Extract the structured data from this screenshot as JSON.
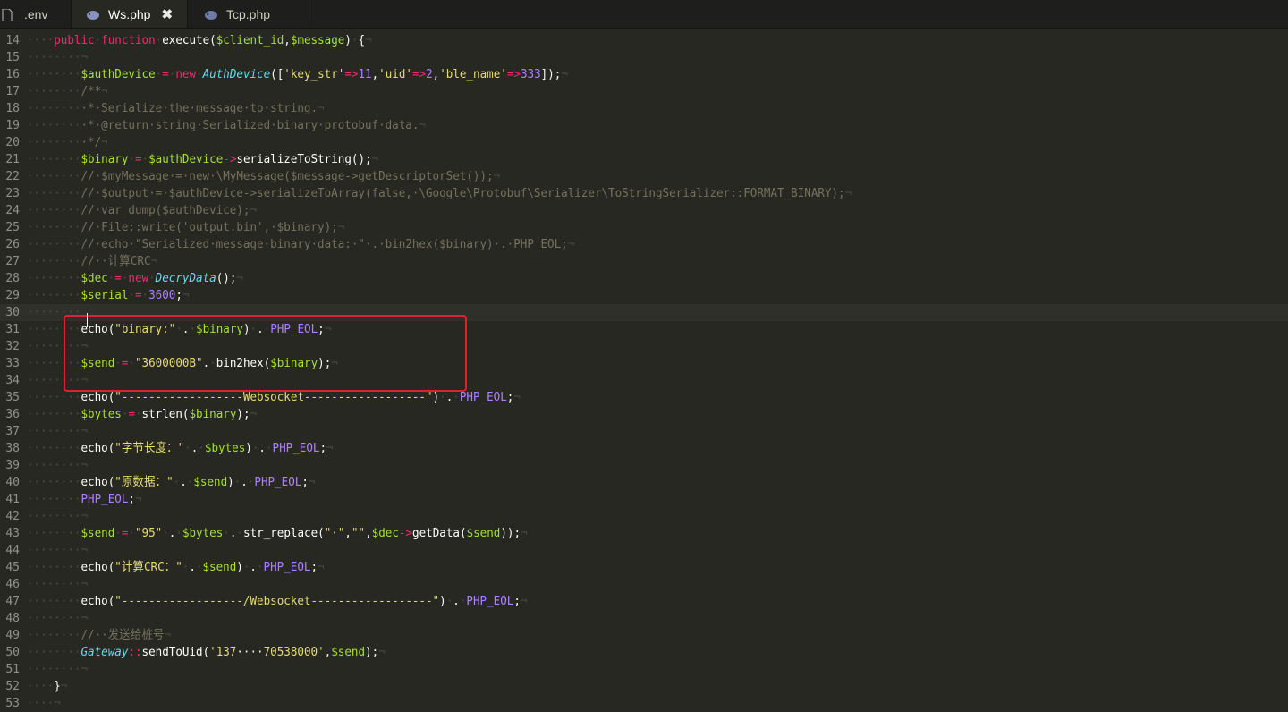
{
  "tabs": [
    {
      "label": ".env",
      "active": false,
      "closable": false
    },
    {
      "label": "Ws.php",
      "active": true,
      "closable": true
    },
    {
      "label": "Tcp.php",
      "active": false,
      "closable": false
    }
  ],
  "close_glyph": "✖",
  "current_line": 30,
  "highlight_box": {
    "color": "#e0202f",
    "from_line": 30,
    "to_line": 33
  },
  "colors": {
    "background": "#272822",
    "keyword": "#f92672",
    "variable": "#a6e22e",
    "string": "#e6db74",
    "number": "#ae81ff",
    "class": "#66d9ef",
    "comment": "#75715e",
    "whitespace": "#4a4b42"
  },
  "code_lines": [
    {
      "n": "13",
      "segs": [
        [
          "ws",
          "····¬"
        ]
      ]
    },
    {
      "n": "14",
      "segs": [
        [
          "ws",
          "····"
        ],
        [
          "kw",
          "public"
        ],
        [
          "ws",
          "·"
        ],
        [
          "kw",
          "function"
        ],
        [
          "ws",
          "·"
        ],
        [
          "fn",
          "execute"
        ],
        [
          "pun",
          "("
        ],
        [
          "var",
          "$client_id"
        ],
        [
          "pun",
          ","
        ],
        [
          "var",
          "$message"
        ],
        [
          "pun",
          ")"
        ],
        [
          "ws",
          "·"
        ],
        [
          "pun",
          "{"
        ],
        [
          "eol",
          "¬"
        ]
      ]
    },
    {
      "n": "15",
      "segs": [
        [
          "ws",
          "········¬"
        ]
      ]
    },
    {
      "n": "16",
      "segs": [
        [
          "ws",
          "········"
        ],
        [
          "var",
          "$authDevice"
        ],
        [
          "ws",
          "·"
        ],
        [
          "op",
          "="
        ],
        [
          "ws",
          "·"
        ],
        [
          "kw",
          "new"
        ],
        [
          "ws",
          "·"
        ],
        [
          "cls",
          "AuthDevice"
        ],
        [
          "pun",
          "(["
        ],
        [
          "str",
          "'key_str'"
        ],
        [
          "op",
          "=>"
        ],
        [
          "num",
          "11"
        ],
        [
          "pun",
          ","
        ],
        [
          "str",
          "'uid'"
        ],
        [
          "op",
          "=>"
        ],
        [
          "num",
          "2"
        ],
        [
          "pun",
          ","
        ],
        [
          "str",
          "'ble_name'"
        ],
        [
          "op",
          "=>"
        ],
        [
          "num",
          "333"
        ],
        [
          "pun",
          "]);"
        ],
        [
          "eol",
          "¬"
        ]
      ]
    },
    {
      "n": "17",
      "segs": [
        [
          "ws",
          "········"
        ],
        [
          "cmt",
          "/**"
        ],
        [
          "eol",
          "¬"
        ]
      ]
    },
    {
      "n": "18",
      "segs": [
        [
          "ws",
          "········"
        ],
        [
          "cmt",
          "·*·Serialize·the·message·to·string."
        ],
        [
          "eol",
          "¬"
        ]
      ]
    },
    {
      "n": "19",
      "segs": [
        [
          "ws",
          "········"
        ],
        [
          "cmt",
          "·*·@return·string·Serialized·binary·protobuf·data."
        ],
        [
          "eol",
          "¬"
        ]
      ]
    },
    {
      "n": "20",
      "segs": [
        [
          "ws",
          "········"
        ],
        [
          "cmt",
          "·*/"
        ],
        [
          "eol",
          "¬"
        ]
      ]
    },
    {
      "n": "21",
      "segs": [
        [
          "ws",
          "········"
        ],
        [
          "var",
          "$binary"
        ],
        [
          "ws",
          "·"
        ],
        [
          "op",
          "="
        ],
        [
          "ws",
          "·"
        ],
        [
          "var",
          "$authDevice"
        ],
        [
          "op",
          "->"
        ],
        [
          "fn",
          "serializeToString"
        ],
        [
          "pun",
          "();"
        ],
        [
          "eol",
          "¬"
        ]
      ]
    },
    {
      "n": "22",
      "segs": [
        [
          "ws",
          "········"
        ],
        [
          "cmt",
          "//·$myMessage·=·new·\\MyMessage($message->getDescriptorSet());"
        ],
        [
          "eol",
          "¬"
        ]
      ]
    },
    {
      "n": "23",
      "segs": [
        [
          "ws",
          "········"
        ],
        [
          "cmt",
          "//·$output·=·$authDevice->serializeToArray(false,·\\Google\\Protobuf\\Serializer\\ToStringSerializer::FORMAT_BINARY);"
        ],
        [
          "eol",
          "¬"
        ]
      ]
    },
    {
      "n": "24",
      "segs": [
        [
          "ws",
          "········"
        ],
        [
          "cmt",
          "//·var_dump($authDevice);"
        ],
        [
          "eol",
          "¬"
        ]
      ]
    },
    {
      "n": "25",
      "segs": [
        [
          "ws",
          "········"
        ],
        [
          "cmt",
          "//·File::write('output.bin',·$binary);"
        ],
        [
          "eol",
          "¬"
        ]
      ]
    },
    {
      "n": "26",
      "segs": [
        [
          "ws",
          "········"
        ],
        [
          "cmt",
          "//·echo·\"Serialized·message·binary·data:·\"·.·bin2hex($binary)·.·PHP_EOL;"
        ],
        [
          "eol",
          "¬"
        ]
      ]
    },
    {
      "n": "27",
      "segs": [
        [
          "ws",
          "········"
        ],
        [
          "cmt",
          "//··计算CRC"
        ],
        [
          "eol",
          "¬"
        ]
      ]
    },
    {
      "n": "28",
      "segs": [
        [
          "ws",
          "········"
        ],
        [
          "var",
          "$dec"
        ],
        [
          "ws",
          "·"
        ],
        [
          "op",
          "="
        ],
        [
          "ws",
          "·"
        ],
        [
          "kw",
          "new"
        ],
        [
          "ws",
          "·"
        ],
        [
          "cls",
          "DecryData"
        ],
        [
          "pun",
          "();"
        ],
        [
          "eol",
          "¬"
        ]
      ]
    },
    {
      "n": "29",
      "segs": [
        [
          "ws",
          "········"
        ],
        [
          "var",
          "$serial"
        ],
        [
          "ws",
          "·"
        ],
        [
          "op",
          "="
        ],
        [
          "ws",
          "·"
        ],
        [
          "num",
          "3600"
        ],
        [
          "pun",
          ";"
        ],
        [
          "eol",
          "¬"
        ]
      ]
    },
    {
      "n": "30",
      "segs": [
        [
          "ws",
          "········"
        ]
      ]
    },
    {
      "n": "31",
      "segs": [
        [
          "ws",
          "········"
        ],
        [
          "fn",
          "echo"
        ],
        [
          "pun",
          "("
        ],
        [
          "str",
          "\"binary:\""
        ],
        [
          "ws",
          "·"
        ],
        [
          "pun",
          "."
        ],
        [
          "ws",
          "·"
        ],
        [
          "var",
          "$binary"
        ],
        [
          "pun",
          ")"
        ],
        [
          "ws",
          "·"
        ],
        [
          "pun",
          "."
        ],
        [
          "ws",
          "·"
        ],
        [
          "const",
          "PHP_EOL"
        ],
        [
          "pun",
          ";"
        ],
        [
          "eol",
          "¬"
        ]
      ]
    },
    {
      "n": "32",
      "segs": [
        [
          "ws",
          "········¬"
        ]
      ]
    },
    {
      "n": "33",
      "segs": [
        [
          "ws",
          "········"
        ],
        [
          "var",
          "$send"
        ],
        [
          "ws",
          "·"
        ],
        [
          "op",
          "="
        ],
        [
          "ws",
          "·"
        ],
        [
          "str",
          "\"3600000B\""
        ],
        [
          "pun",
          "."
        ],
        [
          "ws",
          "·"
        ],
        [
          "fn",
          "bin2hex"
        ],
        [
          "pun",
          "("
        ],
        [
          "var",
          "$binary"
        ],
        [
          "pun",
          ");"
        ],
        [
          "eol",
          "¬"
        ]
      ]
    },
    {
      "n": "34",
      "segs": [
        [
          "ws",
          "········¬"
        ]
      ]
    },
    {
      "n": "35",
      "segs": [
        [
          "ws",
          "········"
        ],
        [
          "fn",
          "echo"
        ],
        [
          "pun",
          "("
        ],
        [
          "str",
          "\"------------------Websocket------------------\""
        ],
        [
          "pun",
          ")"
        ],
        [
          "ws",
          "·"
        ],
        [
          "pun",
          "."
        ],
        [
          "ws",
          "·"
        ],
        [
          "const",
          "PHP_EOL"
        ],
        [
          "pun",
          ";"
        ],
        [
          "eol",
          "¬"
        ]
      ]
    },
    {
      "n": "36",
      "segs": [
        [
          "ws",
          "········"
        ],
        [
          "var",
          "$bytes"
        ],
        [
          "ws",
          "·"
        ],
        [
          "op",
          "="
        ],
        [
          "ws",
          "·"
        ],
        [
          "fn",
          "strlen"
        ],
        [
          "pun",
          "("
        ],
        [
          "var",
          "$binary"
        ],
        [
          "pun",
          ");"
        ],
        [
          "eol",
          "¬"
        ]
      ]
    },
    {
      "n": "37",
      "segs": [
        [
          "ws",
          "········¬"
        ]
      ]
    },
    {
      "n": "38",
      "segs": [
        [
          "ws",
          "········"
        ],
        [
          "fn",
          "echo"
        ],
        [
          "pun",
          "("
        ],
        [
          "str",
          "\"字节长度：\""
        ],
        [
          "ws",
          "·"
        ],
        [
          "pun",
          "."
        ],
        [
          "ws",
          "·"
        ],
        [
          "var",
          "$bytes"
        ],
        [
          "pun",
          ")"
        ],
        [
          "ws",
          "·"
        ],
        [
          "pun",
          "."
        ],
        [
          "ws",
          "·"
        ],
        [
          "const",
          "PHP_EOL"
        ],
        [
          "pun",
          ";"
        ],
        [
          "eol",
          "¬"
        ]
      ]
    },
    {
      "n": "39",
      "segs": [
        [
          "ws",
          "········¬"
        ]
      ]
    },
    {
      "n": "40",
      "segs": [
        [
          "ws",
          "········"
        ],
        [
          "fn",
          "echo"
        ],
        [
          "pun",
          "("
        ],
        [
          "str",
          "\"原数据：\""
        ],
        [
          "ws",
          "·"
        ],
        [
          "pun",
          "."
        ],
        [
          "ws",
          "·"
        ],
        [
          "var",
          "$send"
        ],
        [
          "pun",
          ")"
        ],
        [
          "ws",
          "·"
        ],
        [
          "pun",
          "."
        ],
        [
          "ws",
          "·"
        ],
        [
          "const",
          "PHP_EOL"
        ],
        [
          "pun",
          ";"
        ],
        [
          "eol",
          "¬"
        ]
      ]
    },
    {
      "n": "41",
      "segs": [
        [
          "ws",
          "········"
        ],
        [
          "const",
          "PHP_EOL"
        ],
        [
          "pun",
          ";"
        ],
        [
          "eol",
          "¬"
        ]
      ]
    },
    {
      "n": "42",
      "segs": [
        [
          "ws",
          "········¬"
        ]
      ]
    },
    {
      "n": "43",
      "segs": [
        [
          "ws",
          "········"
        ],
        [
          "var",
          "$send"
        ],
        [
          "ws",
          "·"
        ],
        [
          "op",
          "="
        ],
        [
          "ws",
          "·"
        ],
        [
          "str",
          "\"95\""
        ],
        [
          "ws",
          "·"
        ],
        [
          "pun",
          "."
        ],
        [
          "ws",
          "·"
        ],
        [
          "var",
          "$bytes"
        ],
        [
          "ws",
          "·"
        ],
        [
          "pun",
          "."
        ],
        [
          "ws",
          "·"
        ],
        [
          "fn",
          "str_replace"
        ],
        [
          "pun",
          "("
        ],
        [
          "str",
          "\"·\""
        ],
        [
          "pun",
          ","
        ],
        [
          "str",
          "\"\""
        ],
        [
          "pun",
          ","
        ],
        [
          "var",
          "$dec"
        ],
        [
          "op",
          "->"
        ],
        [
          "fn",
          "getData"
        ],
        [
          "pun",
          "("
        ],
        [
          "var",
          "$send"
        ],
        [
          "pun",
          "));"
        ],
        [
          "eol",
          "¬"
        ]
      ]
    },
    {
      "n": "44",
      "segs": [
        [
          "ws",
          "········¬"
        ]
      ]
    },
    {
      "n": "45",
      "segs": [
        [
          "ws",
          "········"
        ],
        [
          "fn",
          "echo"
        ],
        [
          "pun",
          "("
        ],
        [
          "str",
          "\"计算CRC：\""
        ],
        [
          "ws",
          "·"
        ],
        [
          "pun",
          "."
        ],
        [
          "ws",
          "·"
        ],
        [
          "var",
          "$send"
        ],
        [
          "pun",
          ")"
        ],
        [
          "ws",
          "·"
        ],
        [
          "pun",
          "."
        ],
        [
          "ws",
          "·"
        ],
        [
          "const",
          "PHP_EOL"
        ],
        [
          "pun",
          ";"
        ],
        [
          "eol",
          "¬"
        ]
      ]
    },
    {
      "n": "46",
      "segs": [
        [
          "ws",
          "········¬"
        ]
      ]
    },
    {
      "n": "47",
      "segs": [
        [
          "ws",
          "········"
        ],
        [
          "fn",
          "echo"
        ],
        [
          "pun",
          "("
        ],
        [
          "str",
          "\"------------------/Websocket------------------\""
        ],
        [
          "pun",
          ")"
        ],
        [
          "ws",
          "·"
        ],
        [
          "pun",
          "."
        ],
        [
          "ws",
          "·"
        ],
        [
          "const",
          "PHP_EOL"
        ],
        [
          "pun",
          ";"
        ],
        [
          "eol",
          "¬"
        ]
      ]
    },
    {
      "n": "48",
      "segs": [
        [
          "ws",
          "········¬"
        ]
      ]
    },
    {
      "n": "49",
      "segs": [
        [
          "ws",
          "········"
        ],
        [
          "cmt",
          "//··发送给桩号"
        ],
        [
          "eol",
          "¬"
        ]
      ]
    },
    {
      "n": "50",
      "segs": [
        [
          "ws",
          "········"
        ],
        [
          "cls",
          "Gateway"
        ],
        [
          "op",
          "::"
        ],
        [
          "fn",
          "sendToUid"
        ],
        [
          "pun",
          "("
        ],
        [
          "str",
          "'137"
        ],
        [
          "redacted",
          "····"
        ],
        [
          "str",
          "70538000'"
        ],
        [
          "pun",
          ","
        ],
        [
          "var",
          "$send"
        ],
        [
          "pun",
          ");"
        ],
        [
          "eol",
          "¬"
        ]
      ]
    },
    {
      "n": "51",
      "segs": [
        [
          "ws",
          "········¬"
        ]
      ]
    },
    {
      "n": "52",
      "segs": [
        [
          "ws",
          "····"
        ],
        [
          "pun",
          "}"
        ],
        [
          "eol",
          "¬"
        ]
      ]
    },
    {
      "n": "53",
      "segs": [
        [
          "ws",
          "····¬"
        ]
      ]
    }
  ]
}
